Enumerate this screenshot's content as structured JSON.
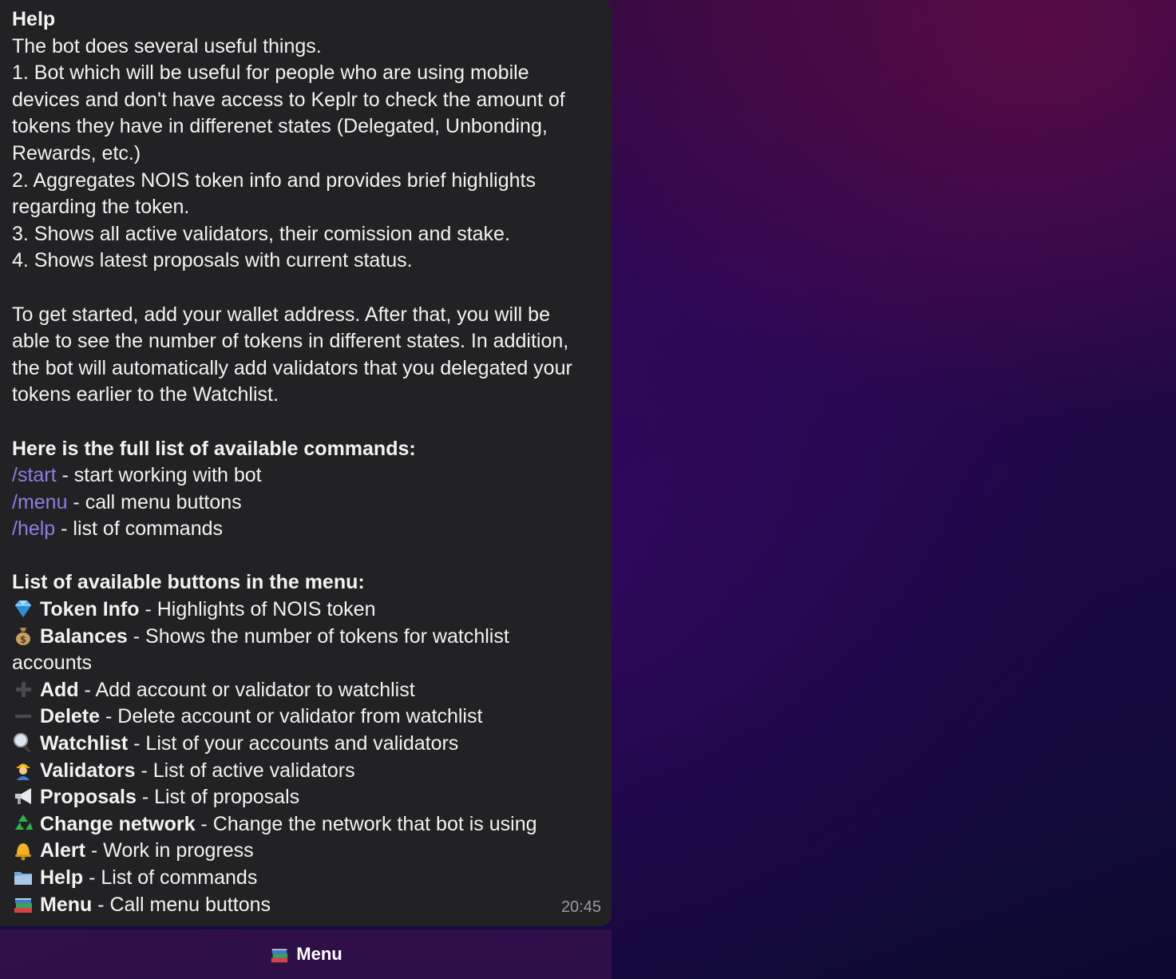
{
  "message": {
    "title": "Help",
    "intro": "The bot does several useful things.",
    "feature_lines": [
      "1. Bot which will be useful for people who are using mobile",
      "devices and don't have access to Keplr to check the amount of",
      "tokens they have in differenet states (Delegated, Unbonding,",
      "Rewards, etc.)",
      "2. Aggregates NOIS token info and provides brief highlights",
      "regarding the token.",
      "3. Shows all active validators, their comission and stake.",
      "4. Shows latest proposals with current status."
    ],
    "getting_started_lines": [
      "To get started, add your wallet address. After that, you will be",
      "able to see the number of tokens in different states. In addition,",
      "the bot will automatically add validators that you delegated your",
      "tokens earlier to the Watchlist."
    ],
    "commands_heading": "Here is the full list of available commands:",
    "commands": [
      {
        "command": "/start",
        "description": " - start working with bot"
      },
      {
        "command": "/menu",
        "description": " - call menu buttons"
      },
      {
        "command": "/help",
        "description": " - list of commands"
      }
    ],
    "buttons_heading": "List of available buttons in the menu:",
    "buttons": [
      {
        "icon": "gem-icon",
        "name": "Token Info",
        "description": " - Highlights of NOIS token"
      },
      {
        "icon": "money-bag-icon",
        "name": "Balances",
        "description": " - Shows the number of tokens for watchlist"
      },
      {
        "icon": "plus-icon",
        "name": "Add",
        "description": " - Add account or validator to watchlist"
      },
      {
        "icon": "minus-icon",
        "name": "Delete",
        "description": " - Delete account or validator from watchlist"
      },
      {
        "icon": "magnifier-icon",
        "name": "Watchlist",
        "description": " - List of your accounts and validators"
      },
      {
        "icon": "worker-icon",
        "name": "Validators",
        "description": " - List of active validators"
      },
      {
        "icon": "megaphone-icon",
        "name": "Proposals",
        "description": " - List of proposals"
      },
      {
        "icon": "recycle-icon",
        "name": "Change network",
        "description": " - Change the network that bot is using"
      },
      {
        "icon": "bell-icon",
        "name": "Alert",
        "description": " - Work in progress"
      },
      {
        "icon": "folder-icon",
        "name": "Help",
        "description": " - List of commands"
      },
      {
        "icon": "books-icon",
        "name": "Menu",
        "description": " - Call menu buttons"
      }
    ],
    "balances_continuation": "accounts",
    "time": "20:45"
  },
  "keyboard": {
    "menu_icon": "books-icon",
    "menu_label": "Menu"
  },
  "colors": {
    "bubble": "#222224",
    "text": "#f2f2f2",
    "command_link": "#8f7de6",
    "timestamp": "#9a9aa0"
  }
}
